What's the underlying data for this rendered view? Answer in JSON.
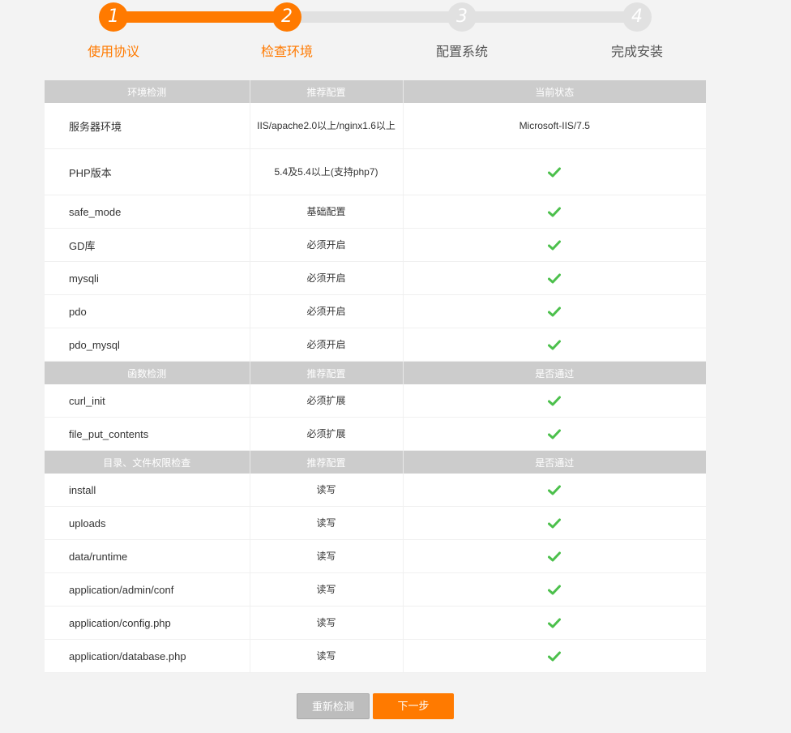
{
  "stepper": {
    "progress_percent": 33,
    "steps": [
      {
        "number": "1",
        "label": "使用协议",
        "state": "active"
      },
      {
        "number": "2",
        "label": "检查环境",
        "state": "active"
      },
      {
        "number": "3",
        "label": "配置系统",
        "state": "inactive"
      },
      {
        "number": "4",
        "label": "完成安装",
        "state": "inactive"
      }
    ]
  },
  "colors": {
    "accent": "#ff7a00",
    "header_bg": "#cccccc",
    "check": "#4cc04c",
    "inactive": "#e1e1e1"
  },
  "sections": [
    {
      "headers": [
        "环境检测",
        "推荐配置",
        "当前状态"
      ],
      "rows": [
        {
          "name": "服务器环境",
          "rec": "IIS/apache2.0以上/nginx1.6以上",
          "status": "Microsoft-IIS/7.5"
        },
        {
          "name": "PHP版本",
          "rec": "5.4及5.4以上(支持php7)",
          "status": "check-icon"
        },
        {
          "name": "safe_mode",
          "rec": "基础配置",
          "status": "check-icon"
        },
        {
          "name": "GD库",
          "rec": "必须开启",
          "status": "check-icon"
        },
        {
          "name": "mysqli",
          "rec": "必须开启",
          "status": "check-icon"
        },
        {
          "name": "pdo",
          "rec": "必须开启",
          "status": "check-icon"
        },
        {
          "name": "pdo_mysql",
          "rec": "必须开启",
          "status": "check-icon"
        }
      ]
    },
    {
      "headers": [
        "函数检测",
        "推荐配置",
        "是否通过"
      ],
      "rows": [
        {
          "name": "curl_init",
          "rec": "必须扩展",
          "status": "check-icon"
        },
        {
          "name": "file_put_contents",
          "rec": "必须扩展",
          "status": "check-icon"
        }
      ]
    },
    {
      "headers": [
        "目录、文件权限检查",
        "推荐配置",
        "是否通过"
      ],
      "rows": [
        {
          "name": "install",
          "rec": "读写",
          "status": "check-icon"
        },
        {
          "name": "uploads",
          "rec": "读写",
          "status": "check-icon"
        },
        {
          "name": "data/runtime",
          "rec": "读写",
          "status": "check-icon"
        },
        {
          "name": "application/admin/conf",
          "rec": "读写",
          "status": "check-icon"
        },
        {
          "name": "application/config.php",
          "rec": "读写",
          "status": "check-icon"
        },
        {
          "name": "application/database.php",
          "rec": "读写",
          "status": "check-icon"
        }
      ]
    }
  ],
  "buttons": {
    "recheck": "重新检测",
    "next": "下一步"
  }
}
